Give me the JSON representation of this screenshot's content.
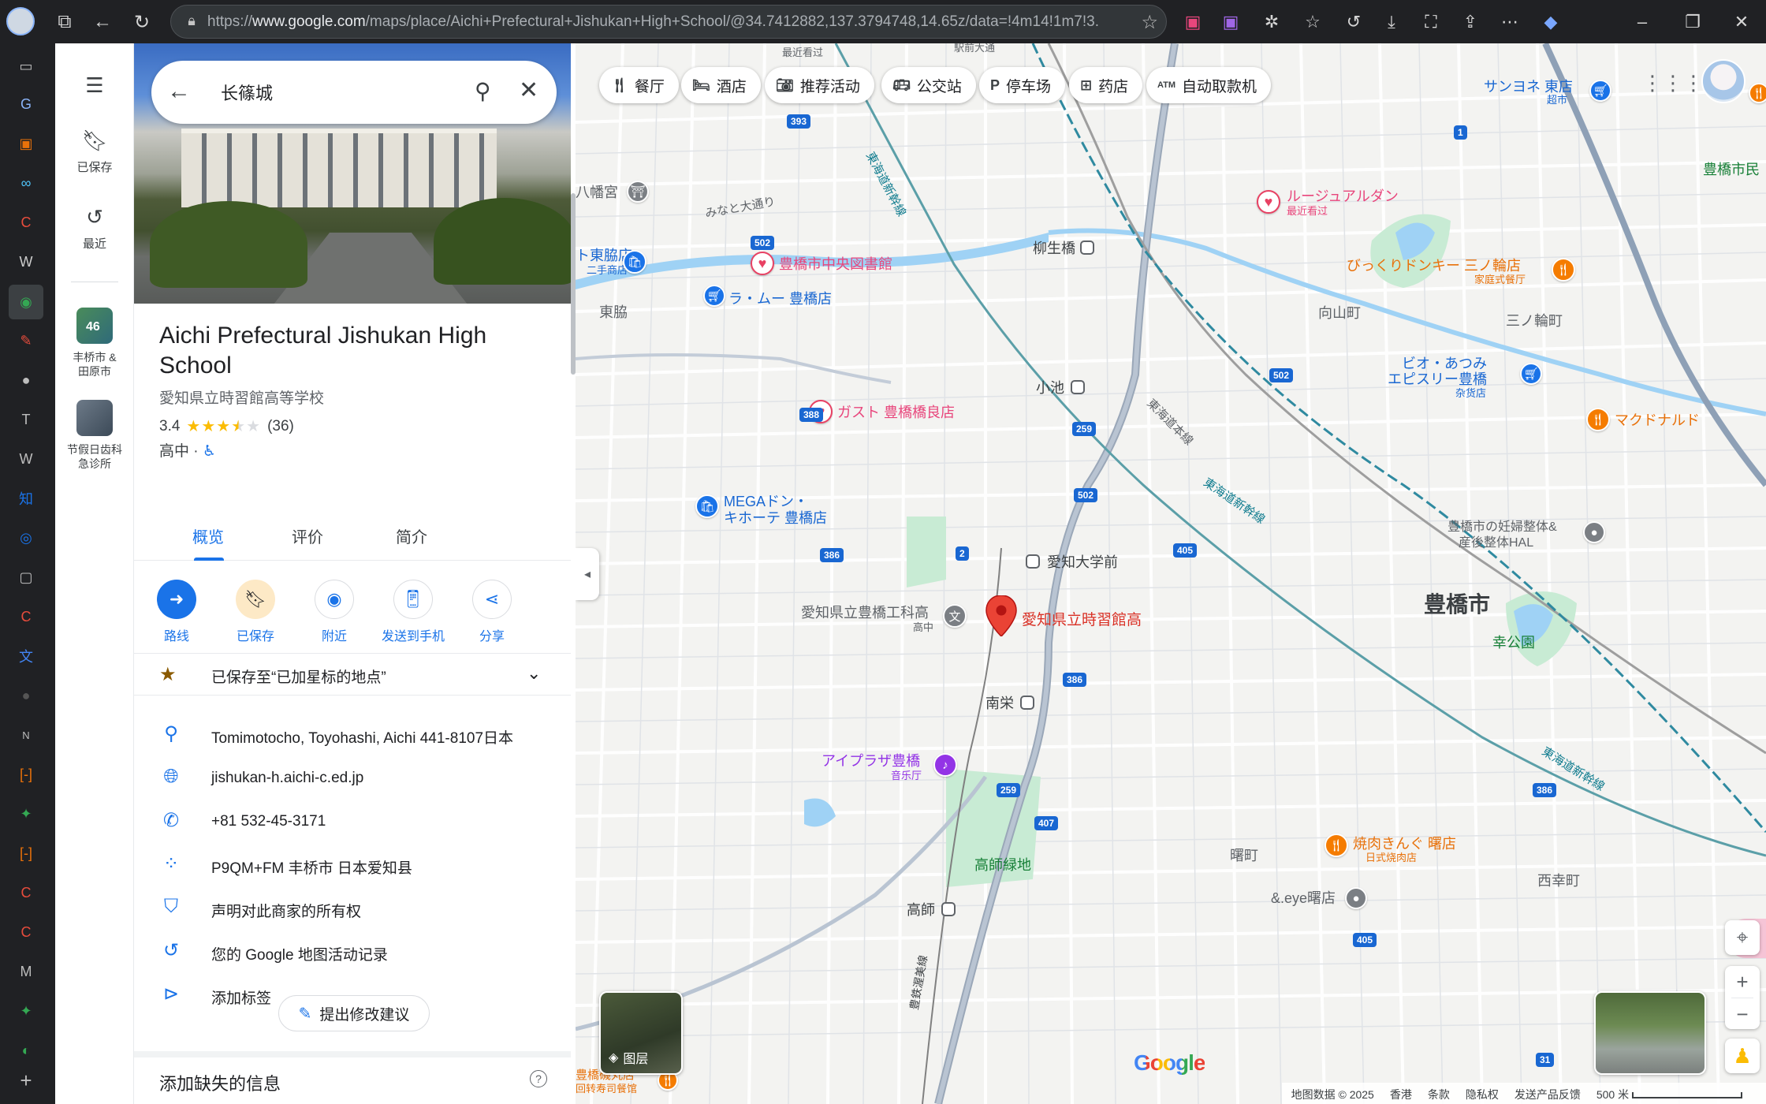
{
  "browser": {
    "url_prefix": "https://",
    "url_host": "www.google.com",
    "url_path": "/maps/place/Aichi+Prefectural+Jishukan+High+School/@34.7412882,137.3794748,14.65z/data=!4m14!1m7!3..."
  },
  "rail": {
    "saved_label": "已保存",
    "recent_label": "最近",
    "recent_item_1_badge": "46",
    "recent_item_1_label_line1": "丰桥市 &",
    "recent_item_1_label_line2": "田原市",
    "recent_item_2_label_line1": "节假日齿科",
    "recent_item_2_label_line2": "急诊所"
  },
  "search": {
    "value": "长篠城"
  },
  "place": {
    "title": "Aichi Prefectural Jishukan High School",
    "subtitle": "愛知県立時習館高等学校",
    "rating": "3.4",
    "review_count": "(36)",
    "category": "高中 · ",
    "accessibility_icon": "♿"
  },
  "tabs": [
    {
      "label": "概览"
    },
    {
      "label": "评价"
    },
    {
      "label": "简介"
    }
  ],
  "actions": [
    {
      "label": "路线"
    },
    {
      "label": "已保存"
    },
    {
      "label": "附近"
    },
    {
      "label": "发送到手机"
    },
    {
      "label": "分享"
    }
  ],
  "saved_list": {
    "text": "已保存至“已加星标的地点”"
  },
  "info": {
    "address": "Tomimotocho, Toyohashi, Aichi 441-8107日本",
    "website": "jishukan-h.aichi-c.ed.jp",
    "phone": "+81 532-45-3171",
    "plus_code": "P9QM+FM 丰桥市 日本爱知县",
    "claim": "声明对此商家的所有权",
    "activity": "您的 Google 地图活动记录",
    "add_label": "添加标签"
  },
  "suggest_edit": "提出修改建议",
  "missing_info_title": "添加缺失的信息",
  "map": {
    "chips": [
      {
        "label": "餐厅"
      },
      {
        "label": "酒店"
      },
      {
        "label": "推荐活动"
      },
      {
        "label": "公交站"
      },
      {
        "label": "停车场"
      },
      {
        "label": "药店"
      },
      {
        "label": "自动取款机"
      }
    ],
    "pin_label": "愛知県立時習館高",
    "city_label": "豊橋市",
    "labels": {
      "hachimangu": "八幡宮",
      "minato_dori": "みなと大通り",
      "higashiwaki_store": "ト東脇店",
      "higashiwaki_store_sub": "二手商店",
      "higashiwaki": "東脇",
      "library": "豊橋市中央図書館",
      "lamu": "ラ・ムー 豊橋店",
      "yanagiuhashi": "柳生橋",
      "koike": "小池",
      "gusto": "ガスト 豊橋橋良店",
      "mega_line1": "MEGAドン・",
      "mega_line2": "キホーテ 豊橋店",
      "aichidaigaku": "愛知大学前",
      "kogyo": "愛知県立豊橋工科高",
      "kogyo_sub": "高中",
      "minamisakae": "南栄",
      "aiplaza": "アイプラザ豊橋",
      "aiplaza_sub": "音乐厅",
      "takashi_ryokuchi": "高師緑地",
      "takashi": "高師",
      "atsumi_line": "豊鉄渥美線",
      "tokaido_shinkansen_1": "東海道新幹線",
      "tokaido_main": "東海道本線",
      "tokaido_shinkansen_2": "東海道新幹線",
      "tokaido_shinkansen_3": "東海道新幹線",
      "sanyone": "サンヨネ 東店",
      "sanyone_sub": "超市",
      "ruju": "ルージュアルダン",
      "ruju_sub": "最近看过",
      "bikkuri": "びっくりドンキー 三ノ輪店",
      "bikkuri_sub": "家庭式餐厅",
      "mukaiyama": "向山町",
      "sannowa": "三ノ輪町",
      "bio_line1": "ビオ・あつみ",
      "bio_line2": "エピスリー豊橋",
      "bio_sub": "杂货店",
      "mcd": "マクドナルド",
      "hal_line1": "豊橋市の妊婦整体&",
      "hal_line2": "産後整体HAL",
      "saiwai_park": "幸公園",
      "yakiniku": "焼肉きんぐ 曙店",
      "yakiniku_sub": "日式烧肉店",
      "akebono": "曙町",
      "eye": "&.eye曙店",
      "nishi_saiwai": "西幸町",
      "city_hall": "豊橋市民",
      "top_recent": "最近看过",
      "top_ekimae": "駅前大通",
      "bottom_sushi": "豊橋磯丸店",
      "bottom_sushi_sub": "回转寿司餐馆"
    },
    "routes": [
      "393",
      "502",
      "388",
      "386",
      "2",
      "259",
      "502",
      "1",
      "502",
      "405",
      "386",
      "259",
      "407",
      "386",
      "405",
      "31"
    ],
    "layers_label": "图层",
    "google_logo": "Google",
    "footer": {
      "data": "地图数据 © 2025",
      "region": "香港",
      "terms": "条款",
      "privacy": "隐私权",
      "feedback": "发送产品反馈",
      "scale": "500 米"
    }
  }
}
